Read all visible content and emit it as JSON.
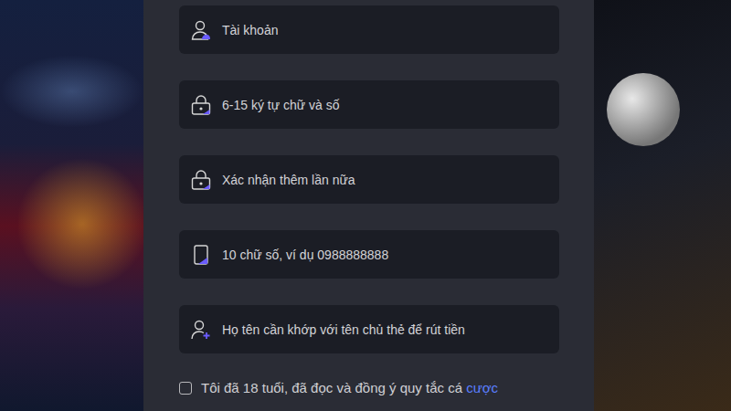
{
  "form": {
    "fields": [
      {
        "placeholder": "Tài khoản"
      },
      {
        "placeholder": "6-15 ký tự chữ và số"
      },
      {
        "placeholder": "Xác nhận thêm lần nữa"
      },
      {
        "placeholder": "10 chữ số, ví dụ 0988888888"
      },
      {
        "placeholder": "Họ tên cần khớp với tên chủ thẻ để rút tiền"
      }
    ],
    "agreement": {
      "checked": false,
      "text": "Tôi đã 18 tuổi, đã đọc và đồng ý quy tắc cá ",
      "link": "cược"
    }
  }
}
